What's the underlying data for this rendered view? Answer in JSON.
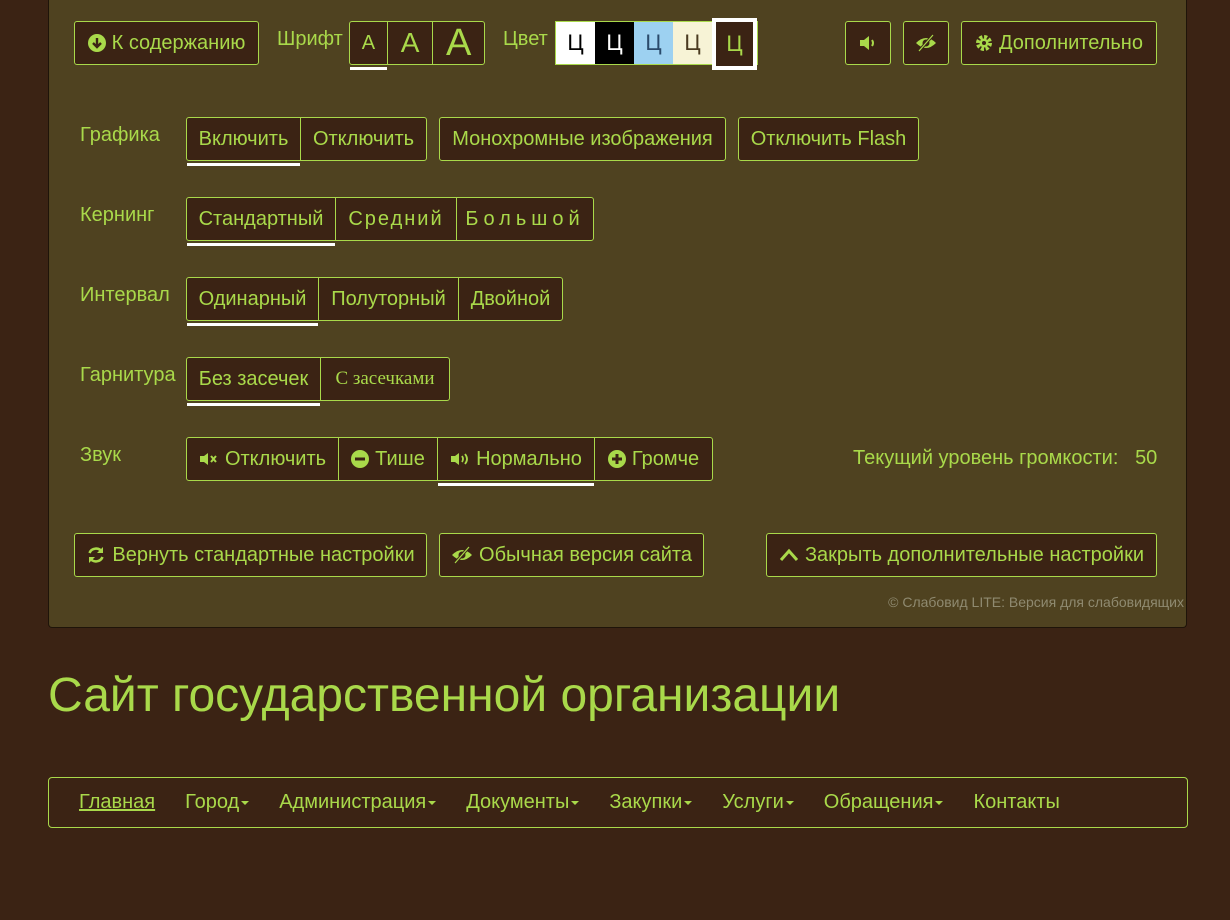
{
  "toolbar": {
    "to_content": "К содержанию",
    "font_label": "Шрифт",
    "font_sizes": [
      "А",
      "А",
      "А"
    ],
    "color_label": "Цвет",
    "color_letter": "Ц",
    "more": "Дополнительно"
  },
  "colors": {
    "accent": "#a9d94a",
    "background": "#3b2314",
    "panel": "#4f4220",
    "schemes": [
      "#ffffff",
      "#000000",
      "#9dd1f1",
      "#f7f3d6",
      "#3b2314"
    ]
  },
  "settings": {
    "graphics": {
      "label": "Графика",
      "options": [
        "Включить",
        "Отключить"
      ],
      "mono": "Монохромные изображения",
      "flash": "Отключить Flash",
      "active": 0
    },
    "kerning": {
      "label": "Кернинг",
      "options": [
        "Стандартный",
        "Средний",
        "Большой"
      ],
      "active": 0
    },
    "interval": {
      "label": "Интервал",
      "options": [
        "Одинарный",
        "Полуторный",
        "Двойной"
      ],
      "active": 0
    },
    "typeface": {
      "label": "Гарнитура",
      "options": [
        "Без засечек",
        "С засечками"
      ],
      "active": 0
    },
    "sound": {
      "label": "Звук",
      "options": [
        "Отключить",
        "Тише",
        "Нормально",
        "Громче"
      ],
      "active": 2,
      "volume_label": "Текущий уровень громкости:",
      "volume": "50"
    }
  },
  "actions": {
    "reset": "Вернуть стандартные настройки",
    "normal": "Обычная версия сайта",
    "close": "Закрыть дополнительные настройки"
  },
  "copyright": "© Слабовид LITE: Версия для слабовидящих",
  "site_title": "Сайт государственной организации",
  "nav": [
    {
      "label": "Главная",
      "dropdown": false
    },
    {
      "label": "Город",
      "dropdown": true
    },
    {
      "label": "Администрация",
      "dropdown": true
    },
    {
      "label": "Документы",
      "dropdown": true
    },
    {
      "label": "Закупки",
      "dropdown": true
    },
    {
      "label": "Услуги",
      "dropdown": true
    },
    {
      "label": "Обращения",
      "dropdown": true
    },
    {
      "label": "Контакты",
      "dropdown": false
    }
  ]
}
